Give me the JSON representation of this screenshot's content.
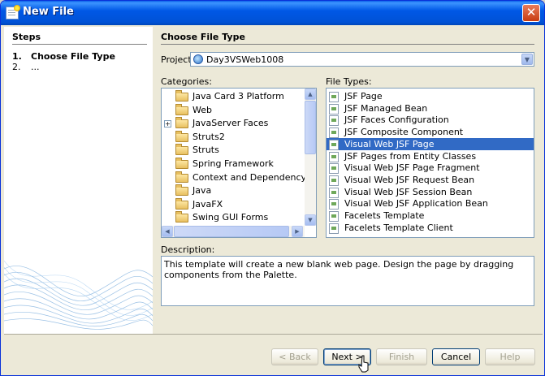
{
  "window": {
    "title": "New File"
  },
  "steps": {
    "title": "Steps",
    "items": [
      {
        "num": "1.",
        "label": "Choose File Type"
      },
      {
        "num": "2.",
        "label": "..."
      }
    ]
  },
  "main": {
    "title": "Choose File Type",
    "project_label": "Project:",
    "project_value": "Day3VSWeb1008",
    "categories_label": "Categories:",
    "filetypes_label": "File Types:",
    "description_label": "Description:",
    "description": "This template will create a new blank web page. Design the page by dragging components from the Palette."
  },
  "categories": [
    {
      "label": "Java Card 3 Platform",
      "expandable": false
    },
    {
      "label": "Web",
      "expandable": false
    },
    {
      "label": "JavaServer Faces",
      "expandable": true
    },
    {
      "label": "Struts2",
      "expandable": false
    },
    {
      "label": "Struts",
      "expandable": false
    },
    {
      "label": "Spring Framework",
      "expandable": false
    },
    {
      "label": "Context and Dependency Inje",
      "expandable": false
    },
    {
      "label": "Java",
      "expandable": false
    },
    {
      "label": "JavaFX",
      "expandable": false
    },
    {
      "label": "Swing GUI Forms",
      "expandable": false
    }
  ],
  "file_types": [
    {
      "label": "JSF Page",
      "selected": false
    },
    {
      "label": "JSF Managed Bean",
      "selected": false
    },
    {
      "label": "JSF Faces Configuration",
      "selected": false
    },
    {
      "label": "JSF Composite Component",
      "selected": false
    },
    {
      "label": "Visual Web JSF Page",
      "selected": true
    },
    {
      "label": "JSF Pages from Entity Classes",
      "selected": false
    },
    {
      "label": "Visual Web JSF Page Fragment",
      "selected": false
    },
    {
      "label": "Visual Web JSF Request Bean",
      "selected": false
    },
    {
      "label": "Visual Web JSF Session Bean",
      "selected": false
    },
    {
      "label": "Visual Web JSF Application Bean",
      "selected": false
    },
    {
      "label": "Facelets Template",
      "selected": false
    },
    {
      "label": "Facelets Template Client",
      "selected": false
    }
  ],
  "buttons": {
    "back": "< Back",
    "next": "Next >",
    "finish": "Finish",
    "cancel": "Cancel",
    "help": "Help"
  },
  "colors": {
    "selection": "#316ac5",
    "titlebar": "#0058e6"
  }
}
